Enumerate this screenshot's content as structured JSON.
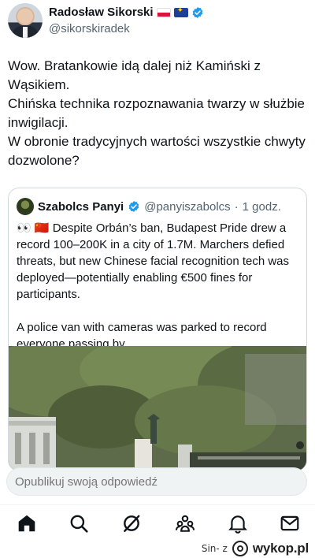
{
  "author": {
    "name": "Radosław Sikorski",
    "handle": "@sikorskiradek",
    "flags": [
      "flag-pl-icon",
      "flag-eu-icon"
    ],
    "verified_icon": "verified-badge-icon"
  },
  "tweet": {
    "text": "Wow. Bratankowie idą dalej niż Kamiński z Wąsikiem.\nChińska technika rozpoznawania twarzy w służbie inwigilacji.\nW obronie tradycyjnych wartości wszystkie chwyty dozwolone?"
  },
  "quoted_tweet": {
    "name": "Szabolcs Panyi",
    "handle": "@panyiszabolcs",
    "separator": "·",
    "time": "1 godz.",
    "text": "👀 🇨🇳 Despite Orbán’s ban, Budapest Pride drew a record 100–200K in a city of 1.7M. Marchers defied threats, but new Chinese facial recognition tech was deployed—potentially enabling €500 fines for participants.\n\nA police van with cameras was parked to record everyone passing by.",
    "media_icon": "video-thumbnail"
  },
  "reply": {
    "placeholder": "Opublikuj swoją odpowiedź"
  },
  "bottom_nav": {
    "items": [
      "home-icon",
      "search-icon",
      "grok-icon",
      "communities-icon",
      "notifications-icon",
      "messages-icon"
    ]
  },
  "watermark": {
    "user": "Sin- z",
    "site": "wykop.pl"
  },
  "colors": {
    "text": "#0f1419",
    "muted": "#536471",
    "verified": "#1d9bf0",
    "border": "#cfd9de"
  }
}
